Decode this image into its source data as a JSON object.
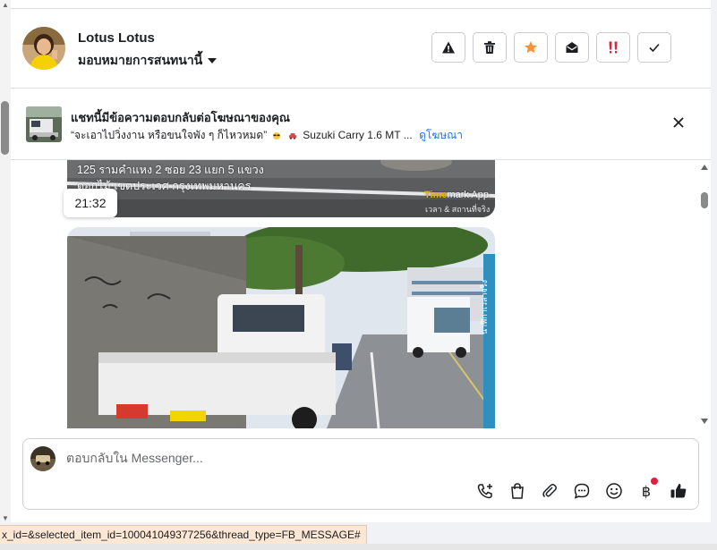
{
  "header": {
    "contact_name": "Lotus Lotus",
    "assign_label": "มอบหมายการสนทนานี้",
    "actions": [
      {
        "name": "report-button",
        "icon": "warning-triangle-icon"
      },
      {
        "name": "delete-button",
        "icon": "trash-icon"
      },
      {
        "name": "star-button",
        "icon": "star-icon",
        "color": "#f7923b"
      },
      {
        "name": "mark-unread-button",
        "icon": "envelope-open-icon"
      },
      {
        "name": "follow-up-button",
        "icon": "double-exclamation-icon",
        "color": "#e41e3f"
      },
      {
        "name": "mark-done-button",
        "icon": "check-icon"
      }
    ]
  },
  "ad_banner": {
    "title": "แชทนี้มีข้อความตอบกลับต่อโฆษณาของคุณ",
    "subtitle_prefix": "“จะเอาไปวิ่งงาน หรือขนใจพัง ๆ ก็ไหวหมด”",
    "subtitle_suffix": "Suzuki Carry 1.6 MT ...",
    "view_ad_link": "ดูโฆษณา"
  },
  "thread": {
    "photo1_address": [
      "125 รามคำแหง 2 ซอย 23 แยก 5 แขวง",
      "ดอกไม้ เขตประเวศ กรุงเทพมหานคร"
    ],
    "photo1_logo_t": "Time",
    "photo1_logo_rest": "mark App",
    "photo1_logo_sub": "เวลา & สถานที่จริง",
    "time": "21:32",
    "photo2_vertical_stamp": "นาฬิกาเวลาจริง"
  },
  "composer": {
    "placeholder": "ตอบกลับใน Messenger...",
    "currency_symbol": "฿"
  },
  "status_url": "x_id=&selected_item_id=100041049377256&thread_type=FB_MESSAGE#"
}
